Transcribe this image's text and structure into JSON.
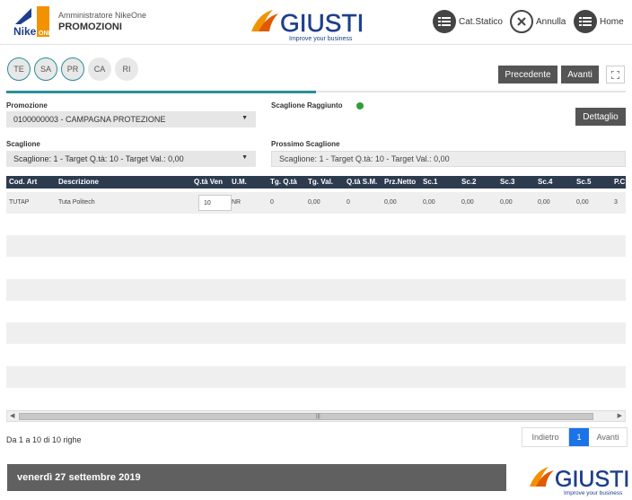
{
  "header": {
    "user_name": "Amministratore NikeOne",
    "section": "PROMOZIONI",
    "logo_left_text": "Nike",
    "logo_brand": "GIUSTI",
    "logo_tagline": "Improve your business",
    "buttons": [
      {
        "label": "Cat.Statico",
        "icon": "list-icon"
      },
      {
        "label": "Annulla",
        "icon": "close-circle-icon"
      },
      {
        "label": "Home",
        "icon": "list-icon"
      }
    ]
  },
  "steps": [
    "TE",
    "SA",
    "PR",
    "CA",
    "RI"
  ],
  "steps_completed": 3,
  "nav": {
    "prev": "Precedente",
    "next": "Avanti"
  },
  "progress": 0.5,
  "form": {
    "promo_label": "Promozione",
    "promo_value": "0100000003 - CAMPAGNA PROTEZIONE",
    "reached_label": "Scaglione Raggiunto",
    "detail_button": "Dettaglio",
    "tier_label": "Scaglione",
    "tier_value": "Scaglione: 1 - Target Q.tà: 10 - Target Val.: 0,00",
    "next_tier_label": "Prossimo Scaglione",
    "next_tier_value": "Scaglione: 1 - Target Q.tà: 10 - Target Val.: 0,00"
  },
  "table": {
    "columns": [
      "Cod. Art",
      "Descrizione",
      "Q.tà Ven",
      "U.M.",
      "Tg. Q.tà",
      "Tg. Val.",
      "Q.tà S.M.",
      "Prz.Netto",
      "Sc.1",
      "Sc.2",
      "Sc.3",
      "Sc.4",
      "Sc.5",
      "P.C"
    ],
    "rows": [
      {
        "cod": "TUTAP",
        "desc": "Tuta Politech",
        "qty": "10",
        "um": "NR",
        "tgq": "0",
        "tgv": "0,00",
        "qsm": "0",
        "prz": "0,00",
        "sc1": "0,00",
        "sc2": "0,00",
        "sc3": "0,00",
        "sc4": "0,00",
        "sc5": "0,00",
        "pc": "3"
      }
    ]
  },
  "footer": {
    "rows_info": "Da 1 a 10 di 10 righe",
    "pager_prev": "Indietro",
    "pager_page": "1",
    "pager_next": "Avanti",
    "date": "venerdì 27 settembre 2019"
  },
  "colors": {
    "accent": "#2a8f99",
    "header_table": "#2d3b4f",
    "orange": "#f39200",
    "blue": "#1d3f8c",
    "page_active": "#1a73e8"
  }
}
